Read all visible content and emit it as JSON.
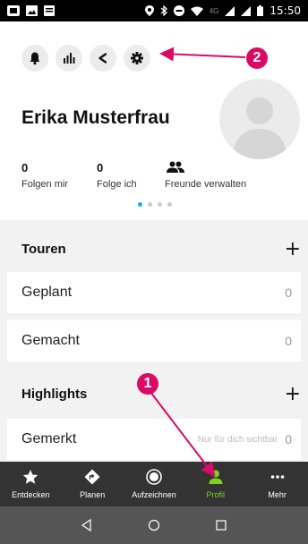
{
  "status_bar": {
    "time": "15:50",
    "network": "4G"
  },
  "profile": {
    "actions": [
      {
        "icon": "bell-icon"
      },
      {
        "icon": "bar-chart-icon"
      },
      {
        "icon": "share-icon"
      },
      {
        "icon": "gear-icon"
      }
    ],
    "name": "Erika Musterfrau",
    "stats": [
      {
        "value": "0",
        "label": "Folgen mir"
      },
      {
        "value": "0",
        "label": "Folge ich"
      },
      {
        "value": "",
        "label": "Freunde verwalten",
        "icon": "people-icon"
      }
    ],
    "pager": {
      "count": 4,
      "active_index": 0
    }
  },
  "sections": {
    "touren": {
      "title": "Touren",
      "add_label": "+",
      "items": [
        {
          "label": "Geplant",
          "value": "0"
        },
        {
          "label": "Gemacht",
          "value": "0"
        }
      ]
    },
    "highlights": {
      "title": "Highlights",
      "add_label": "+",
      "items": [
        {
          "label": "Gemerkt",
          "note": "Nur für dich sichtbar",
          "value": "0"
        }
      ]
    }
  },
  "bottom_nav": {
    "items": [
      {
        "label": "Entdecken",
        "icon": "star-icon"
      },
      {
        "label": "Planen",
        "icon": "directions-icon"
      },
      {
        "label": "Aufzeichnen",
        "icon": "record-icon"
      },
      {
        "label": "Profil",
        "icon": "person-icon",
        "active": true
      },
      {
        "label": "Mehr",
        "icon": "more-icon"
      }
    ],
    "active_color": "#7ed321"
  },
  "annotations": {
    "badge_1": "1",
    "badge_2": "2",
    "color": "#d90b64"
  },
  "colors": {
    "accent_dot": "#29a9e1",
    "nav_bg": "#333333",
    "sys_nav_bg": "#555555"
  }
}
